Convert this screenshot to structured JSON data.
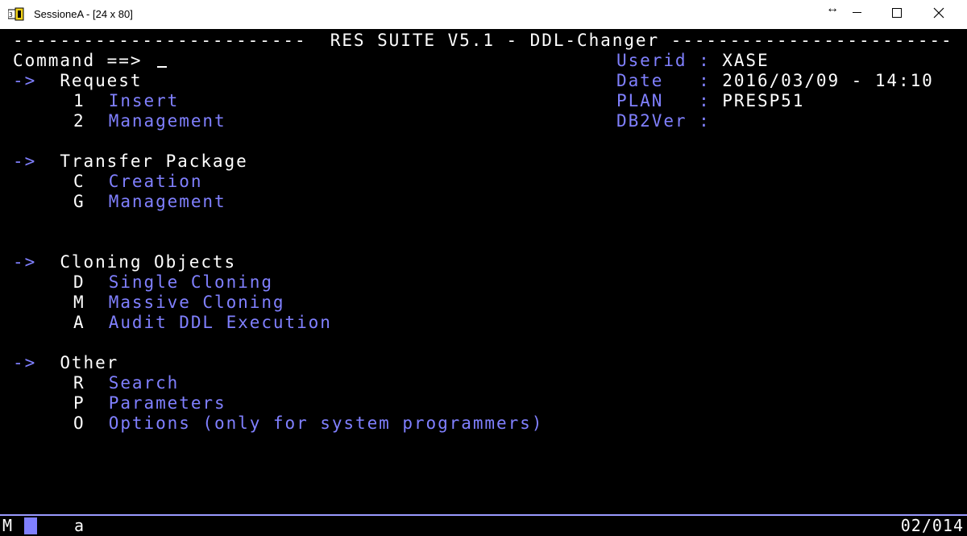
{
  "window": {
    "title": "SessioneA - [24 x 80]",
    "resize_glyph": "↔",
    "icon": "terminal-emulator-icon"
  },
  "terminal": {
    "header": "-------------------------  RES SUITE V5.1 - DDL-Changer ------------------------",
    "command_label": "Command ==>",
    "command_value": "",
    "info": {
      "userid_label": "Userid :",
      "userid_value": "XASE",
      "date_label": "Date   :",
      "date_value": "2016/03/09 - 14:10",
      "plan_label": "PLAN   :",
      "plan_value": "PRESP51",
      "db2ver_label": "DB2Ver :",
      "db2ver_value": ""
    },
    "arrow": "->",
    "sections": [
      {
        "title": "Request",
        "options": [
          {
            "key": "1",
            "label": "Insert"
          },
          {
            "key": "2",
            "label": "Management"
          }
        ]
      },
      {
        "title": "Transfer Package",
        "options": [
          {
            "key": "C",
            "label": "Creation"
          },
          {
            "key": "G",
            "label": "Management"
          }
        ]
      },
      {
        "title": "Cloning Objects",
        "options": [
          {
            "key": "D",
            "label": "Single Cloning"
          },
          {
            "key": "M",
            "label": "Massive Cloning"
          },
          {
            "key": "A",
            "label": "Audit DDL Execution"
          }
        ]
      },
      {
        "title": "Other",
        "options": [
          {
            "key": "R",
            "label": "Search"
          },
          {
            "key": "P",
            "label": "Parameters"
          },
          {
            "key": "O",
            "label": "Options (only for system programmers)"
          }
        ]
      }
    ]
  },
  "status": {
    "mode": "M",
    "char": "a",
    "position": "02/014"
  },
  "colors": {
    "background": "#000000",
    "text": "#ffffff",
    "highlight": "#8080ff"
  }
}
